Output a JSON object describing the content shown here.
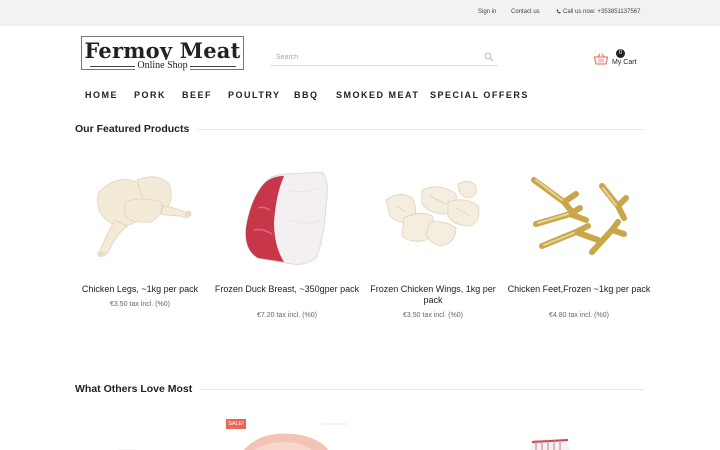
{
  "topbar": {
    "sign_in": "Sign in",
    "contact": "Contact us",
    "phone": "Call us now: +353851137567"
  },
  "logo": {
    "title": "Fermoy Meat",
    "subtitle": "Online Shop"
  },
  "search": {
    "placeholder": "Search",
    "value": ""
  },
  "cart": {
    "count": "0",
    "label": "My Cart"
  },
  "nav": {
    "items": [
      {
        "label": "HOME"
      },
      {
        "label": "PORK"
      },
      {
        "label": "BEEF"
      },
      {
        "label": "POULTRY"
      },
      {
        "label": "BBQ"
      },
      {
        "label": "SMOKED MEAT"
      },
      {
        "label": "SPECIAL OFFERS"
      }
    ]
  },
  "featured": {
    "title": "Our Featured Products",
    "products": [
      {
        "name": "Chicken Legs, ~1kg per pack",
        "price": "€3.50 tax incl. (%0)",
        "image": "chicken-legs"
      },
      {
        "name": "Frozen Duck Breast, ~350gper pack",
        "price": "€7.20 tax incl. (%0)",
        "image": "duck-breast"
      },
      {
        "name": "Frozen Chicken Wings, 1kg per pack",
        "price": "€3.50 tax incl. (%0)",
        "image": "chicken-wings"
      },
      {
        "name": "Chicken Feet,Frozen ~1kg per pack",
        "price": "€4.80 tax incl. (%0)",
        "image": "chicken-feet"
      }
    ]
  },
  "loved": {
    "title": "What Others Love Most",
    "sale_badge": "SALE!"
  },
  "colors": {
    "accent": "#e8665a",
    "topbar_bg": "#f2f2f2",
    "text": "#222222"
  }
}
